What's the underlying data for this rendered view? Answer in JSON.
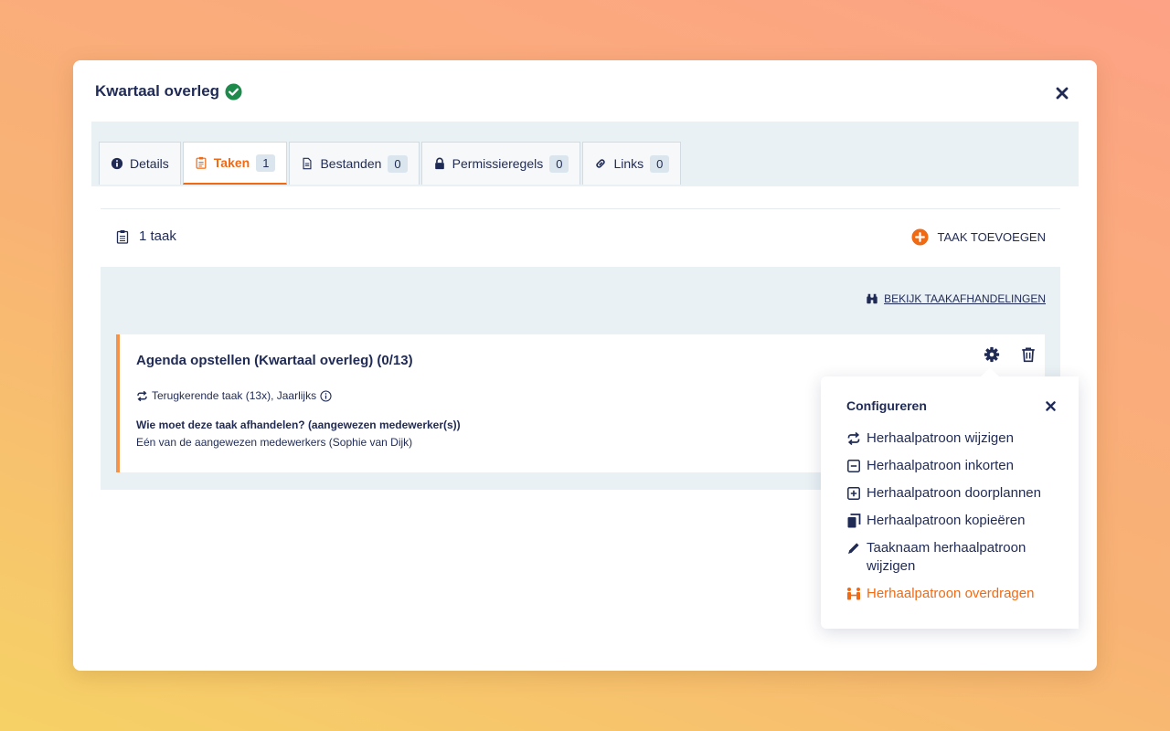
{
  "modal": {
    "title": "Kwartaal overleg",
    "accent_color": "#f06a14",
    "text_color": "#1f2a55",
    "check_color": "#1e8a4c"
  },
  "tabs": [
    {
      "label": "Details",
      "icon": "info-circle-icon",
      "count": null,
      "active": false
    },
    {
      "label": "Taken",
      "icon": "clipboard-icon",
      "count": "1",
      "active": true
    },
    {
      "label": "Bestanden",
      "icon": "file-icon",
      "count": "0",
      "active": false
    },
    {
      "label": "Permissieregels",
      "icon": "lock-icon",
      "count": "0",
      "active": false
    },
    {
      "label": "Links",
      "icon": "link-icon",
      "count": "0",
      "active": false
    }
  ],
  "toolbar": {
    "task_count": "1 taak",
    "add_task": "TAAK TOEVOEGEN"
  },
  "panel": {
    "view_link": "BEKIJK TAAKAFHANDELINGEN"
  },
  "task": {
    "title": "Agenda opstellen (Kwartaal overleg) (0/13)",
    "recurrence": "Terugkerende taak (13x), Jaarlijks",
    "question": "Wie moet deze taak afhandelen? (aangewezen medewerker(s))",
    "assignee": "Eén van de aangewezen medewerkers (Sophie van Dijk)"
  },
  "popover": {
    "title": "Configureren",
    "items": [
      {
        "label": "Herhaalpatroon wijzigen",
        "icon": "repeat-icon"
      },
      {
        "label": "Herhaalpatroon inkorten",
        "icon": "minus-square-icon"
      },
      {
        "label": "Herhaalpatroon doorplannen",
        "icon": "plus-square-icon"
      },
      {
        "label": "Herhaalpatroon kopieëren",
        "icon": "copy-icon"
      },
      {
        "label": "Taaknaam herhaalpatroon wijzigen",
        "icon": "pencil-icon"
      },
      {
        "label": "Herhaalpatroon overdragen",
        "icon": "transfer-users-icon"
      }
    ]
  }
}
